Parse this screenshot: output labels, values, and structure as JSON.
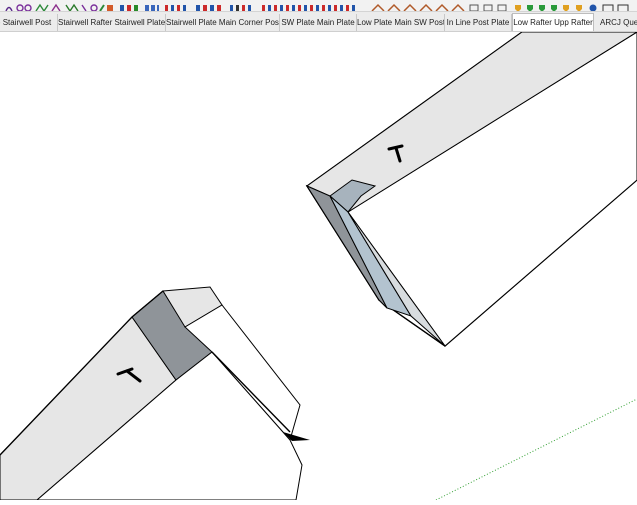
{
  "toolbar": {
    "icons": [
      "draw-tool-icon",
      "arc-tool-icon",
      "curve-tool-icon",
      "push-pull-icon",
      "paint-icon",
      "layer-icon",
      "component-icon",
      "dimension-icon",
      "section-icon",
      "style-icon",
      "shadow-icon"
    ]
  },
  "tabs": [
    {
      "label": "te Stairwell Post",
      "active": false
    },
    {
      "label": "Stairwell Rafter Stairwell Plate",
      "active": false
    },
    {
      "label": "Stairwell Plate Main Corner Post",
      "active": false
    },
    {
      "label": "SW Plate Main Plate",
      "active": false
    },
    {
      "label": "Low Plate Main SW Post",
      "active": false
    },
    {
      "label": "In Line Post Plate",
      "active": false
    },
    {
      "label": "Low Rafter Upp Rafter",
      "active": true
    },
    {
      "label": "ARCJ Queer",
      "active": false
    }
  ],
  "colors": {
    "face_light": "#e6e6e6",
    "face_white": "#ffffff",
    "face_dark": "#8f9499",
    "face_blue": "#b3c3cf",
    "edge": "#000000",
    "guide": "#33a033"
  }
}
